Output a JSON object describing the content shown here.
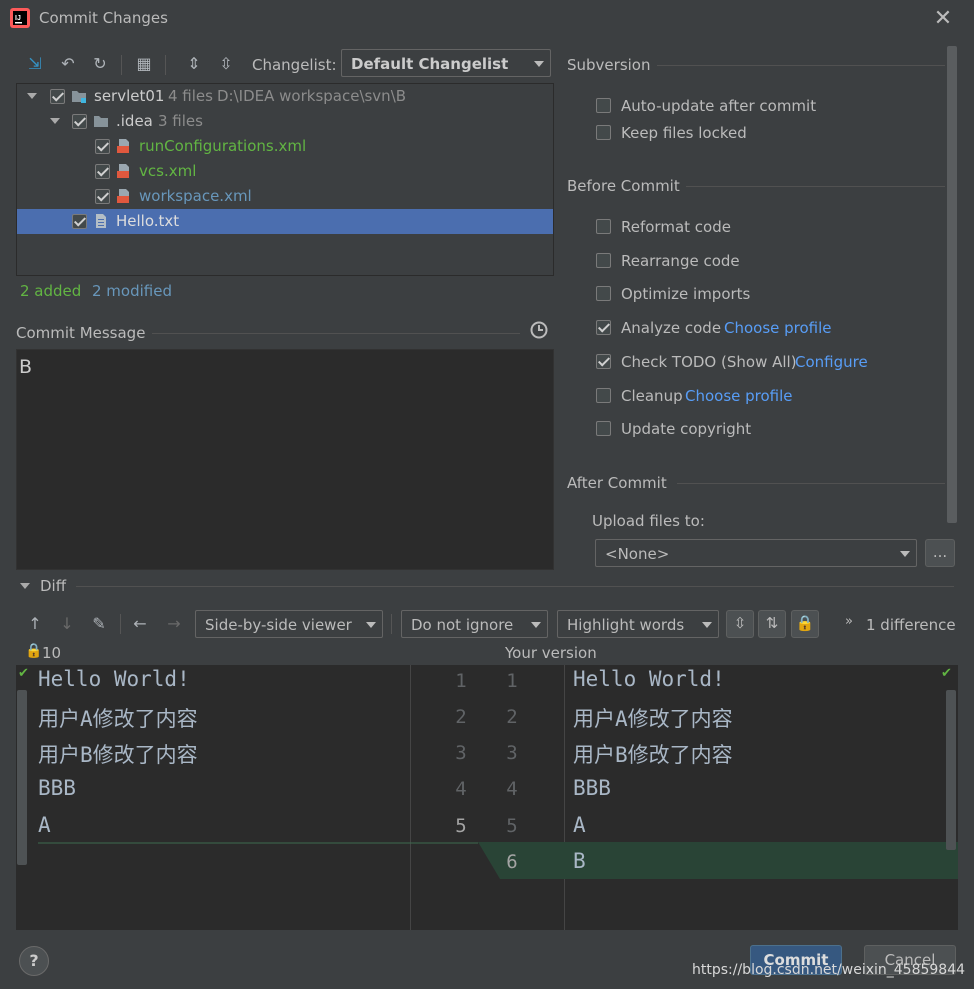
{
  "window": {
    "title": "Commit Changes"
  },
  "toolbar": {
    "changelist_label": "Changelist:",
    "changelist_value": "Default Changelist"
  },
  "tree": {
    "rows": [
      {
        "name": "servlet01",
        "count": "4 files",
        "path": "D:\\IDEA workspace\\svn\\B"
      },
      {
        "name": ".idea",
        "count": "3 files"
      },
      {
        "name": "runConfigurations.xml"
      },
      {
        "name": "vcs.xml"
      },
      {
        "name": "workspace.xml"
      },
      {
        "name": "Hello.txt"
      }
    ],
    "added": "2 added",
    "modified": "2 modified"
  },
  "commit": {
    "label": "Commit Message",
    "text": "B"
  },
  "subversion": {
    "title": "Subversion",
    "options": [
      {
        "label": "Auto-update after commit",
        "checked": false
      },
      {
        "label": "Keep files locked",
        "checked": false
      }
    ]
  },
  "before": {
    "title": "Before Commit",
    "options": [
      {
        "label": "Reformat code",
        "checked": false,
        "link": ""
      },
      {
        "label": "Rearrange code",
        "checked": false,
        "link": ""
      },
      {
        "label": "Optimize imports",
        "checked": false,
        "link": ""
      },
      {
        "label": "Analyze code",
        "checked": true,
        "link": "Choose profile"
      },
      {
        "label": "Check TODO (Show All)",
        "checked": true,
        "link": "Configure"
      },
      {
        "label": "Cleanup",
        "checked": false,
        "link": "Choose profile"
      },
      {
        "label": "Update copyright",
        "checked": false,
        "link": ""
      }
    ]
  },
  "after": {
    "title": "After Commit",
    "upload_label": "Upload files to:",
    "upload_value": "<None>",
    "browse": "..."
  },
  "diff": {
    "title": "Diff",
    "viewer": "Side-by-side viewer",
    "ignore": "Do not ignore",
    "highlight": "Highlight words",
    "differences": "1 difference",
    "left_header": "10",
    "right_header": "Your version",
    "left_lines": [
      "Hello World!",
      "用户A修改了内容",
      "用户B修改了内容",
      "BBB",
      "A"
    ],
    "left_numbers": [
      "1",
      "2",
      "3",
      "4",
      "5"
    ],
    "right_numbers": [
      "1",
      "2",
      "3",
      "4",
      "5",
      "6"
    ],
    "right_lines": [
      "Hello World!",
      "用户A修改了内容",
      "用户B修改了内容",
      "BBB",
      "A",
      "B"
    ]
  },
  "buttons": {
    "help": "?",
    "commit": "Commit",
    "cancel": "Cancel"
  },
  "watermark": "https://blog.csdn.net/weixin_45859844",
  "colors": {
    "selection": "#4b6eaf",
    "added_line": "#294436",
    "accent": "#589df6"
  }
}
